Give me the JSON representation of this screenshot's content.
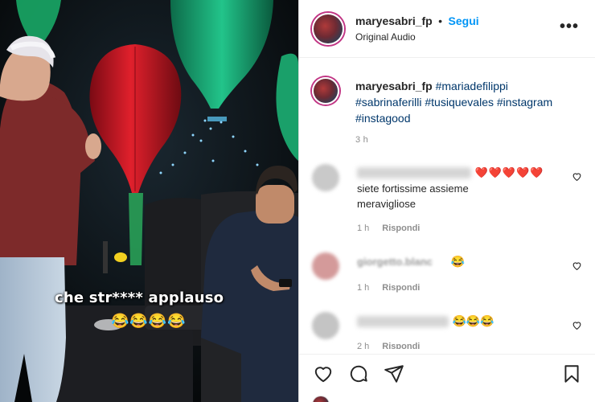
{
  "post": {
    "username": "maryesabri_fp",
    "follow_label": "Segui",
    "separator": "•",
    "audio": "Original Audio",
    "more_label": "•••"
  },
  "video": {
    "caption": "che str**** applauso",
    "caption_emoji": "😂😂😂😂"
  },
  "description": {
    "username": "maryesabri_fp",
    "hashtags": [
      "#mariadefilippi",
      "#sabrinaferilli",
      "#tusiquevales",
      "#instagram",
      "#instagood"
    ],
    "time": "3 h"
  },
  "comments": [
    {
      "text_line1": "❤️❤️❤️❤️❤️",
      "text_line2": "siete fortissime assieme",
      "text_line3": "meravigliose",
      "time": "1 h",
      "reply": "Rispondi"
    },
    {
      "name": "giorgetto.blanc",
      "text": "😂",
      "time": "1 h",
      "reply": "Rispondi"
    },
    {
      "text": "😂😂😂",
      "time": "2 h",
      "reply": "Rispondi"
    }
  ],
  "colors": {
    "link": "#0095f6",
    "hashtag": "#00376b",
    "muted": "#8e8e8e",
    "heart": "#ed4956"
  }
}
